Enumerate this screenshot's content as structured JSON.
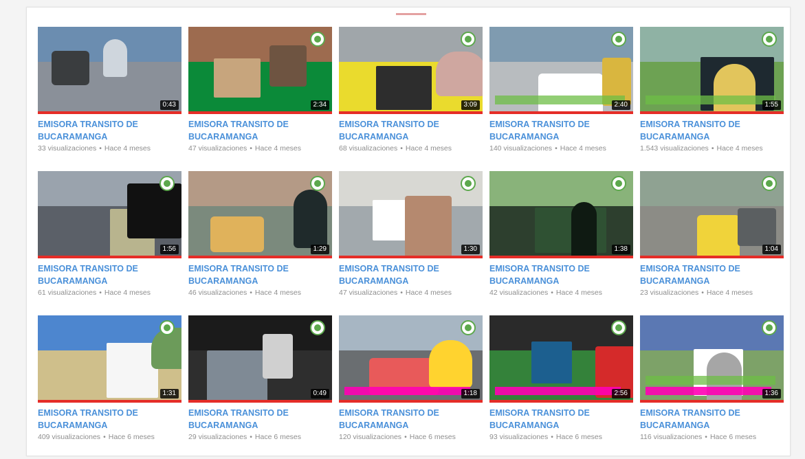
{
  "videos": [
    {
      "title": "EMISORA TRANSITO DE BUCARAMANGA",
      "duration": "0:43",
      "views": "33 visualizaciones",
      "age": "Hace 4 meses",
      "palette": {
        "sky": "#6b8db0",
        "ground": "#8a9099",
        "b1": "#3a3d3f",
        "b2": "#cfd6dd"
      },
      "has_logo": false
    },
    {
      "title": "EMISORA TRANSITO DE BUCARAMANGA",
      "duration": "2:34",
      "views": "47 visualizaciones",
      "age": "Hace 4 meses",
      "palette": {
        "sky": "#9d6b4f",
        "ground": "#0b8a39",
        "b1": "#c7a57d",
        "b2": "#6e5441"
      },
      "has_logo": true
    },
    {
      "title": "EMISORA TRANSITO DE BUCARAMANGA",
      "duration": "3:09",
      "views": "68 visualizaciones",
      "age": "Hace 4 meses",
      "palette": {
        "sky": "#a0a6aa",
        "ground": "#eadb2d",
        "b1": "#2d2d2d",
        "b2": "#cfa7a0"
      },
      "has_logo": true
    },
    {
      "title": "EMISORA TRANSITO DE BUCARAMANGA",
      "duration": "2:40",
      "views": "140 visualizaciones",
      "age": "Hace 4 meses",
      "palette": {
        "sky": "#7f9bb0",
        "ground": "#b8bcbf",
        "b1": "#ffffff",
        "b2": "#d9b63f"
      },
      "has_logo": true
    },
    {
      "title": "EMISORA TRANSITO DE BUCARAMANGA",
      "duration": "1:55",
      "views": "1.543 visualizaciones",
      "age": "Hace 4 meses",
      "palette": {
        "sky": "#8fb2a4",
        "ground": "#6da253",
        "b1": "#1e2930",
        "b2": "#e2c55c"
      },
      "has_logo": true
    },
    {
      "title": "EMISORA TRANSITO DE BUCARAMANGA",
      "duration": "1:56",
      "views": "61 visualizaciones",
      "age": "Hace 4 meses",
      "palette": {
        "sky": "#9aa3ad",
        "ground": "#5b6068",
        "b1": "#b8b48e",
        "b2": "#111"
      },
      "has_logo": true
    },
    {
      "title": "EMISORA TRANSITO DE BUCARAMANGA",
      "duration": "1:29",
      "views": "46 visualizaciones",
      "age": "Hace 4 meses",
      "palette": {
        "sky": "#b49a86",
        "ground": "#7b8a7d",
        "b1": "#e0b25b",
        "b2": "#1f2a2b"
      },
      "has_logo": true
    },
    {
      "title": "EMISORA TRANSITO DE BUCARAMANGA",
      "duration": "1:30",
      "views": "47 visualizaciones",
      "age": "Hace 4 meses",
      "palette": {
        "sky": "#d8d8d3",
        "ground": "#a2a9ad",
        "b1": "#ffffff",
        "b2": "#b5896f"
      },
      "has_logo": true
    },
    {
      "title": "EMISORA TRANSITO DE BUCARAMANGA",
      "duration": "1:38",
      "views": "42 visualizaciones",
      "age": "Hace 4 meses",
      "palette": {
        "sky": "#89b37a",
        "ground": "#2d3f2e",
        "b1": "#2f5133",
        "b2": "#0f1a12"
      },
      "has_logo": true
    },
    {
      "title": "EMISORA TRANSITO DE BUCARAMANGA",
      "duration": "1:04",
      "views": "23 visualizaciones",
      "age": "Hace 4 meses",
      "palette": {
        "sky": "#8fa292",
        "ground": "#8c8c86",
        "b1": "#f0d33a",
        "b2": "#5b5f61"
      },
      "has_logo": true
    },
    {
      "title": "EMISORA TRANSITO DE BUCARAMANGA",
      "duration": "1:31",
      "views": "409 visualizaciones",
      "age": "Hace 6 meses",
      "palette": {
        "sky": "#4d86cf",
        "ground": "#cfbf8b",
        "b1": "#f6f6f6",
        "b2": "#6c9b5a"
      },
      "has_logo": true
    },
    {
      "title": "EMISORA TRANSITO DE BUCARAMANGA",
      "duration": "0:49",
      "views": "29 visualizaciones",
      "age": "Hace 6 meses",
      "palette": {
        "sky": "#1b1b1b",
        "ground": "#2e2e2e",
        "b1": "#7f8a95",
        "b2": "#d0d0d0"
      },
      "has_logo": true
    },
    {
      "title": "EMISORA TRANSITO DE BUCARAMANGA",
      "duration": "1:18",
      "views": "120 visualizaciones",
      "age": "Hace 6 meses",
      "palette": {
        "sky": "#a7b6c3",
        "ground": "#6a6e71",
        "b1": "#e85a5a",
        "b2": "#ffd32f"
      },
      "has_logo": true
    },
    {
      "title": "EMISORA TRANSITO DE BUCARAMANGA",
      "duration": "2:56",
      "views": "93 visualizaciones",
      "age": "Hace 6 meses",
      "palette": {
        "sky": "#2a2a2a",
        "ground": "#34823a",
        "b1": "#1c5f8f",
        "b2": "#d52a2a"
      },
      "has_logo": true
    },
    {
      "title": "EMISORA TRANSITO DE BUCARAMANGA",
      "duration": "1:36",
      "views": "116 visualizaciones",
      "age": "Hace 6 meses",
      "palette": {
        "sky": "#5b78b3",
        "ground": "#7da268",
        "b1": "#ffffff",
        "b2": "#a6a6a6"
      },
      "has_logo": true
    }
  ]
}
